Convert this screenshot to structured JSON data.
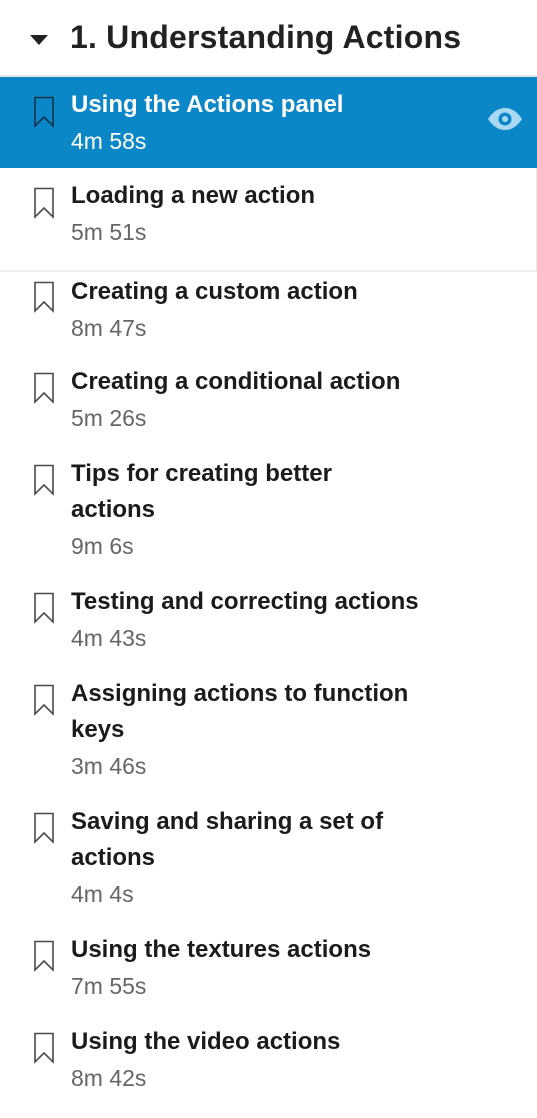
{
  "chapter": {
    "title": "1. Understanding Actions",
    "caret_icon": "caret-down-icon"
  },
  "colors": {
    "active_bg": "#0b87c8",
    "text": "#1b1b1b",
    "duration": "#666666"
  },
  "items": [
    {
      "title": "Using the Actions panel",
      "duration": "4m 58s",
      "active": true,
      "icon": "bookmark-icon",
      "watch_icon": "eye-icon"
    },
    {
      "title": "Loading a new action",
      "duration": "5m 51s",
      "active": false,
      "icon": "bookmark-icon"
    },
    {
      "title": "Creating a custom action",
      "duration": "8m 47s",
      "active": false,
      "icon": "bookmark-icon"
    },
    {
      "title": "Creating a conditional action",
      "duration": "5m 26s",
      "active": false,
      "icon": "bookmark-icon"
    },
    {
      "title": "Tips for creating better actions",
      "duration": "9m 6s",
      "active": false,
      "icon": "bookmark-icon"
    },
    {
      "title": "Testing and correcting actions",
      "duration": "4m 43s",
      "active": false,
      "icon": "bookmark-icon"
    },
    {
      "title": "Assigning actions to function keys",
      "duration": "3m 46s",
      "active": false,
      "icon": "bookmark-icon"
    },
    {
      "title": "Saving and sharing a set of actions",
      "duration": "4m 4s",
      "active": false,
      "icon": "bookmark-icon"
    },
    {
      "title": "Using the textures actions",
      "duration": "7m 55s",
      "active": false,
      "icon": "bookmark-icon"
    },
    {
      "title": "Using the video actions",
      "duration": "8m 42s",
      "active": false,
      "icon": "bookmark-icon"
    }
  ]
}
